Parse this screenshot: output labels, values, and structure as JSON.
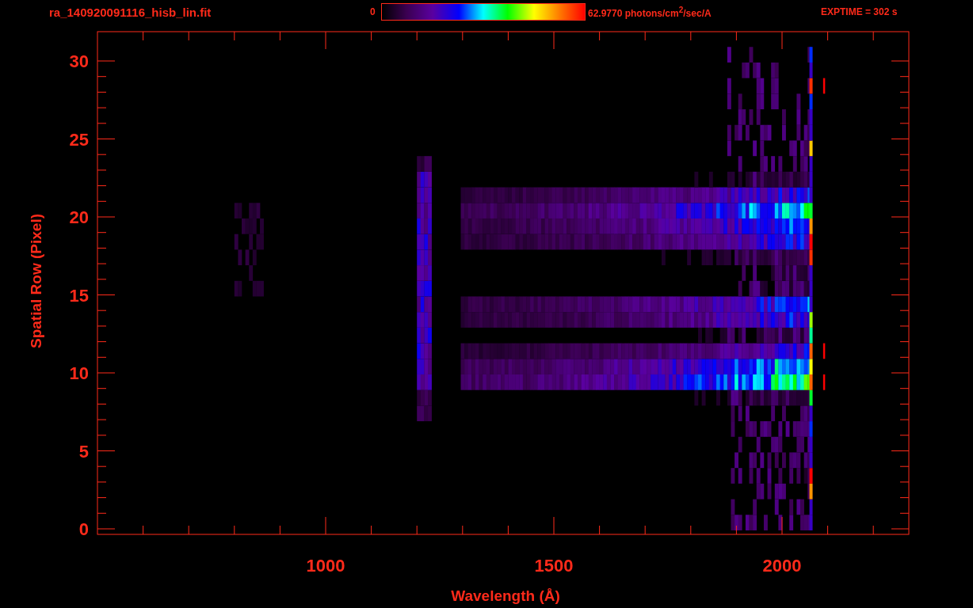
{
  "title": "ra_140920091116_hisb_lin.fit",
  "color_scale": {
    "min_label": "0",
    "max_label": "62.9770 photons/cm$^{2}$/sec/A"
  },
  "exposure": "EXPTIME = 302 s",
  "y_axis": {
    "label": "Spatial Row (Pixel)",
    "tick_labels": [
      "30",
      "25",
      "20",
      "15",
      "10",
      "5",
      "0"
    ]
  },
  "x_axis": {
    "label": "Wavelength (Å)",
    "tick_labels": [
      "1000",
      "1500",
      "2000"
    ]
  }
}
